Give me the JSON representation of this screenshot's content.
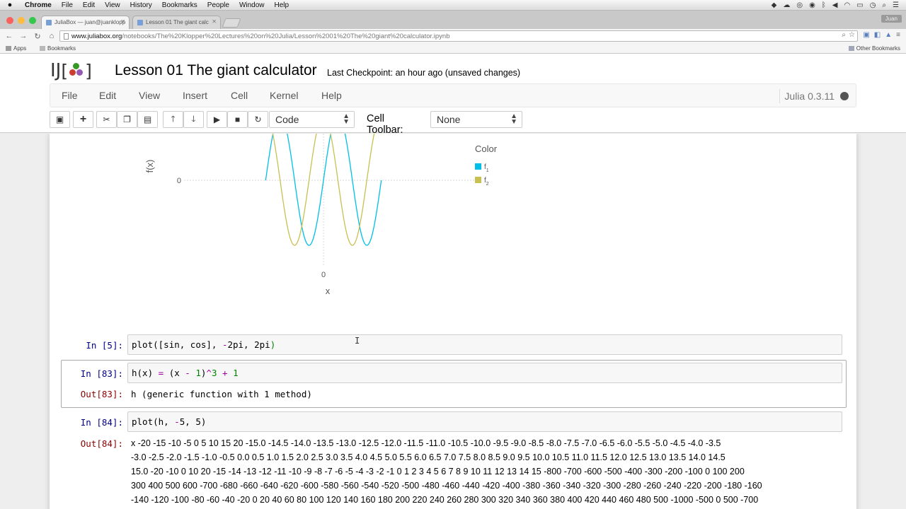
{
  "macos": {
    "app": "Chrome",
    "menus": [
      "File",
      "Edit",
      "View",
      "History",
      "Bookmarks",
      "People",
      "Window",
      "Help"
    ]
  },
  "browser": {
    "tabs": [
      {
        "title": "JuliaBox — juan@juanklopp",
        "active": true
      },
      {
        "title": "Lesson 01 The giant calc",
        "active": false
      }
    ],
    "user": "Juan",
    "url_host": "www.juliabox.org",
    "url_path": "/notebooks/The%20Klopper%20Lectures%20on%20Julia/Lesson%2001%20The%20giant%20calculator.ipynb",
    "bookmarks": {
      "apps": "Apps",
      "bookmarks": "Bookmarks",
      "other": "Other Bookmarks"
    }
  },
  "notebook": {
    "logo_text": "IJ",
    "title": "Lesson 01 The giant calculator",
    "checkpoint": "Last Checkpoint: an hour ago (unsaved changes)",
    "menu": [
      "File",
      "Edit",
      "View",
      "Insert",
      "Cell",
      "Kernel",
      "Help"
    ],
    "kernel": "Julia 0.3.11",
    "toolbar": {
      "cell_type": "Code",
      "cell_toolbar_label": "Cell Toolbar:",
      "cell_toolbar_value": "None"
    }
  },
  "chart_data": {
    "type": "line",
    "ylabel": "f(x)",
    "xlabel": "x",
    "y_ticks": [
      "0"
    ],
    "x_ticks": [
      "0"
    ],
    "legend_title": "Color",
    "legend_placement": "right",
    "series": [
      {
        "name": "f1",
        "label_main": "f",
        "label_sub": "1",
        "color": "#00bfe6",
        "function": "sin"
      },
      {
        "name": "f2",
        "label_main": "f",
        "label_sub": "2",
        "color": "#c8c050",
        "function": "cos"
      }
    ],
    "x_range": [
      -6.283,
      6.283
    ]
  },
  "cells": {
    "c5": {
      "prompt": "In [5]:",
      "code_pre": "plot(",
      "code_mid": "[sin, cos], ",
      "code_minus": "-",
      "code_a": "2pi, 2pi",
      "code_post": ")"
    },
    "c83": {
      "prompt": "In [83]:",
      "out_prompt": "Out[83]:",
      "out": "h (generic function with 1 method)"
    },
    "c84": {
      "prompt": "In [84]:",
      "code_a": "plot(h, ",
      "code_minus": "-",
      "code_b": "5, 5)",
      "out_prompt": "Out[84]:",
      "out_lines": [
        "x -20 -15 -10 -5 0 5 10 15 20 -15.0 -14.5 -14.0 -13.5 -13.0 -12.5 -12.0 -11.5 -11.0 -10.5 -10.0 -9.5 -9.0 -8.5 -8.0 -7.5 -7.0 -6.5 -6.0 -5.5 -5.0 -4.5 -4.0 -3.5",
        "-3.0 -2.5 -2.0 -1.5 -1.0 -0.5 0.0 0.5 1.0 1.5 2.0 2.5 3.0 3.5 4.0 4.5 5.0 5.5 6.0 6.5 7.0 7.5 8.0 8.5 9.0 9.5 10.0 10.5 11.0 11.5 12.0 12.5 13.0 13.5 14.0 14.5",
        "15.0 -20 -10 0 10 20 -15 -14 -13 -12 -11 -10 -9 -8 -7 -6 -5 -4 -3 -2 -1 0 1 2 3 4 5 6 7 8 9 10 11 12 13 14 15 -800 -700 -600 -500 -400 -300 -200 -100 0 100 200",
        "300 400 500 600 -700 -680 -660 -640 -620 -600 -580 -560 -540 -520 -500 -480 -460 -440 -420 -400 -380 -360 -340 -320 -300 -280 -260 -240 -220 -200 -180 -160",
        "-140 -120 -100 -80 -60 -40 -20 0 20 40 60 80 100 120 140 160 180 200 220 240 260 280 300 320 340 360 380 400 420 440 460 480 500 -1000 -500 0 500 -700"
      ]
    }
  }
}
